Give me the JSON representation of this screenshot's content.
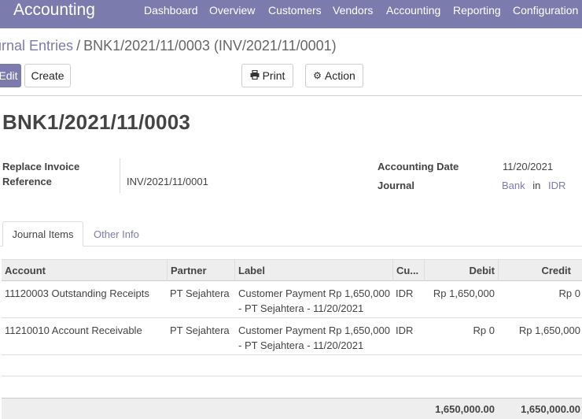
{
  "navbar": {
    "app_title": "Accounting",
    "menu": [
      "Dashboard",
      "Overview",
      "Customers",
      "Vendors",
      "Accounting",
      "Reporting",
      "Configuration"
    ]
  },
  "breadcrumb": {
    "parent": "urnal Entries",
    "separator": "/",
    "current": "BNK1/2021/11/0003 (INV/2021/11/0001)"
  },
  "buttons": {
    "edit": "Edit",
    "create": "Create",
    "print": "Print",
    "action": "Action"
  },
  "record": {
    "title": "BNK1/2021/11/0003",
    "replace_invoice_label": "Replace Invoice",
    "reference_label": "Reference",
    "reference_value": "INV/2021/11/0001",
    "accounting_date_label": "Accounting Date",
    "accounting_date_value": "11/20/2021",
    "journal_label": "Journal",
    "journal_value": "Bank",
    "journal_in": "in",
    "journal_currency": "IDR"
  },
  "tabs": [
    "Journal Items",
    "Other Info"
  ],
  "table": {
    "columns": [
      "Account",
      "Partner",
      "Label",
      "Cu...",
      "Debit",
      "Credit"
    ],
    "rows": [
      {
        "account": "11120003 Outstanding Receipts",
        "partner": "PT Sejahtera",
        "label_1": "Customer Payment Rp 1,650,000",
        "label_2": "- PT Sejahtera - 11/20/2021",
        "currency": "IDR",
        "debit": "Rp 1,650,000",
        "credit": "Rp 0"
      },
      {
        "account": "11210010 Account Receivable",
        "partner": "PT Sejahtera",
        "label_1": "Customer Payment Rp 1,650,000",
        "label_2": "- PT Sejahtera - 11/20/2021",
        "currency": "IDR",
        "debit": "Rp 0",
        "credit": "Rp 1,650,000"
      }
    ],
    "total_debit": "1,650,000.00",
    "total_credit": "1,650,000.00"
  },
  "colors": {
    "brand": "#7c7bad",
    "header_bg": "#eeeeee"
  }
}
